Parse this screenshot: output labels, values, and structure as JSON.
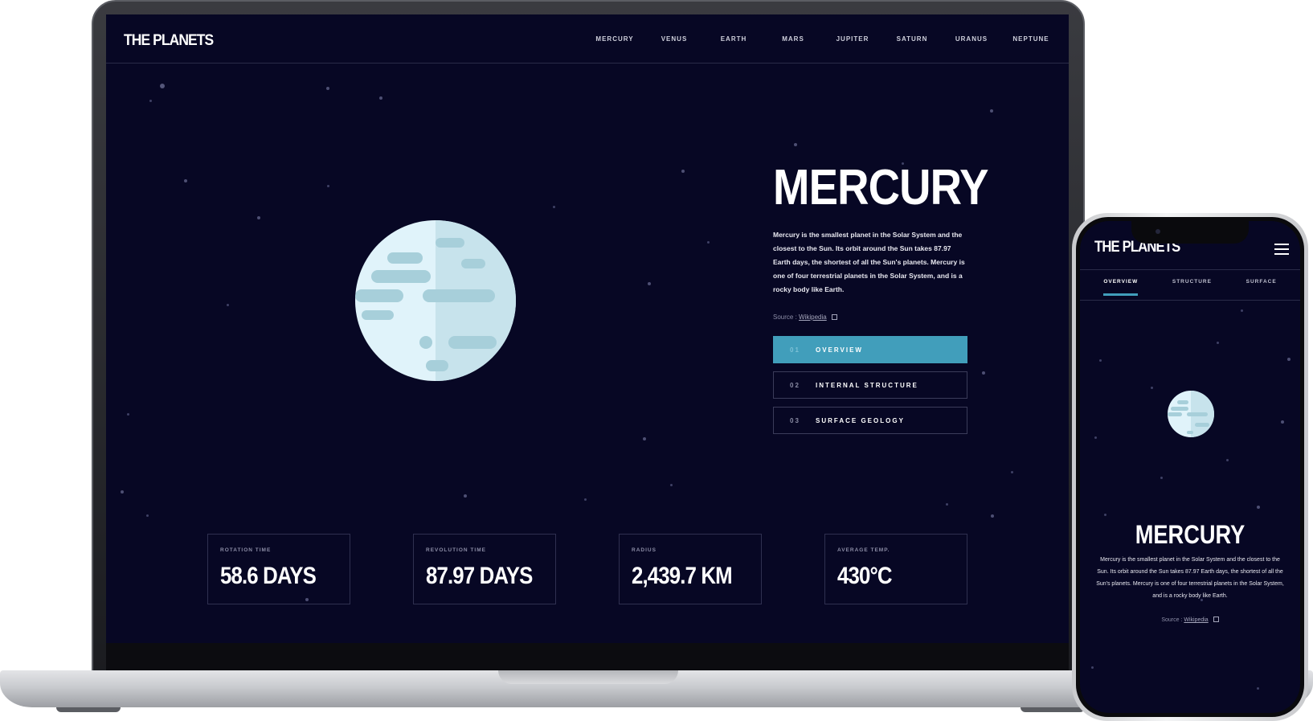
{
  "desktop": {
    "logo": "THE PLANETS",
    "nav": [
      "MERCURY",
      "VENUS",
      "EARTH",
      "MARS",
      "JUPITER",
      "SATURN",
      "URANUS",
      "NEPTUNE"
    ],
    "planet": {
      "name": "MERCURY",
      "description": "Mercury is the smallest planet in the Solar System and the closest to the Sun. Its orbit around the Sun takes 87.97 Earth days, the shortest of all the Sun's planets. Mercury is one of four terrestrial planets in the Solar System, and is a rocky body like Earth.",
      "source_label": "Source :",
      "source_link": "Wikipedia"
    },
    "tabs": [
      {
        "num": "01",
        "label": "OVERVIEW"
      },
      {
        "num": "02",
        "label": "INTERNAL STRUCTURE"
      },
      {
        "num": "03",
        "label": "SURFACE GEOLOGY"
      }
    ],
    "stats": [
      {
        "label": "ROTATION TIME",
        "value": "58.6 DAYS"
      },
      {
        "label": "REVOLUTION TIME",
        "value": "87.97 DAYS"
      },
      {
        "label": "RADIUS",
        "value": "2,439.7 KM"
      },
      {
        "label": "AVERAGE TEMP.",
        "value": "430°C"
      }
    ]
  },
  "mobile": {
    "logo": "THE PLANETS",
    "tabs": [
      "OVERVIEW",
      "STRUCTURE",
      "SURFACE"
    ],
    "planet_name": "MERCURY",
    "description": "Mercury is the smallest planet in the Solar System and the closest to the Sun. Its orbit around the Sun takes 87.97 Earth days, the shortest of all the Sun's planets. Mercury is one of four terrestrial planets in the Solar System, and is a rocky body like Earth.",
    "source_label": "Source :",
    "source_link": "Wikipedia"
  },
  "colors": {
    "background": "#070724",
    "accent": "#419EBB",
    "planet_light": "#E0F3FA",
    "planet_spots": "#A7CFDA"
  }
}
